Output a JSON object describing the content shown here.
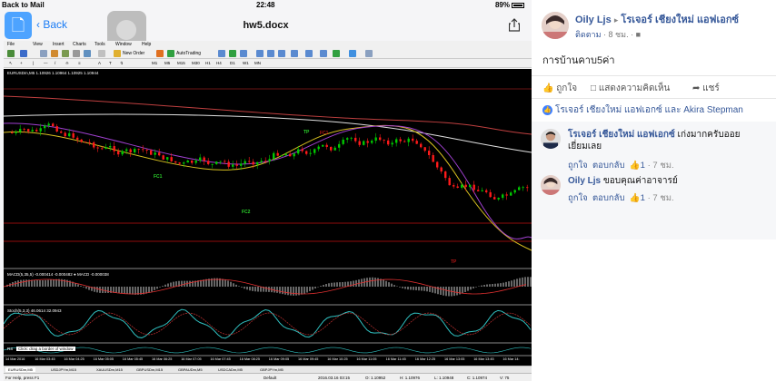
{
  "status_bar": {
    "back": "Back to Mail",
    "time": "22:48",
    "battery": "89%"
  },
  "nav": {
    "back_label": "Back",
    "doc_title": "hw5.docx"
  },
  "mt4": {
    "menu": [
      "File",
      "View",
      "Insert",
      "Charts",
      "Tools",
      "Window",
      "Help"
    ],
    "toolbar": {
      "new_order": "New Order",
      "autotrading": "AutoTrading"
    },
    "timeframes": [
      "M1",
      "M5",
      "M15",
      "M30",
      "H1",
      "H4",
      "D1",
      "W1",
      "MN"
    ],
    "chart": {
      "symbol_header": "EURUSDm,M5  1.10926 1.10964 1.10925 1.10944",
      "wave_labels": [
        "FC1",
        "FC2"
      ],
      "tp_labels": [
        "TP",
        "FC1",
        "TP"
      ],
      "macd_label": "MACD(5,35,5) -0.000414 -0.000482 ● MACD -0.000038",
      "stoch_label": "Stoch(5,3,3) 46.0614 32.0943",
      "rsi_label": "RS",
      "tooltip": "Click: drag a border of window",
      "time_labels": [
        "14 Mar 2016",
        "16 Mar 03:45",
        "16 Mar 04:25",
        "16 Mar 05:05",
        "16 Mar 05:45",
        "16 Mar 06:25",
        "16 Mar 07:05",
        "16 Mar 07:45",
        "16 Mar 08:25",
        "16 Mar 09:05",
        "16 Mar 09:45",
        "16 Mar 10:25",
        "16 Mar 11:05",
        "16 Mar 11:45",
        "16 Mar 12:25",
        "16 Mar 13:05",
        "16 Mar 13:45",
        "16 Mar 14:"
      ]
    },
    "symbol_tabs": [
      "EURUSDm,M5",
      "USDJPYm,M15",
      "XAUUSDm,M15",
      "GBPUSDm,M15",
      "GBPAUDm,M5",
      "USDCADm,M5",
      "GBPJPYm,M5"
    ],
    "status": {
      "help": "For Help, press F1",
      "profile": "Default",
      "datetime": "2016.03.16 03:15",
      "open": "O: 1.10952",
      "high": "H: 1.10976",
      "low": "L: 1.10948",
      "close": "C: 1.10974",
      "volume": "V: 75"
    }
  },
  "fb": {
    "post": {
      "author": "Oily Ljs",
      "arrow": "▸",
      "target": "โรเจอร์ เชียงใหม่ แอฟเอกซ์",
      "follow": "ติดตาม",
      "time": "8 ชม.",
      "text": "การบ้านคาบ5ค่า"
    },
    "actions": {
      "like": "ถูกใจ",
      "comment": "แสดงความคิดเห็น",
      "share": "แชร์"
    },
    "reactions": "โรเจอร์ เชียงใหม่ แอฟเอกซ์ และ Akira Stepman",
    "comments": [
      {
        "author": "โรเจอร์ เชียงใหม่ แอฟเอกซ์",
        "text_line1": "เก่งมากครับออย",
        "text_line2": "เยี่ยมเลย",
        "like": "ถูกใจ",
        "reply": "ตอบกลับ",
        "likes": "1",
        "time": "7 ชม."
      },
      {
        "author": "Oily Ljs",
        "text": "ขอบคุณค่าอาจารย์",
        "like": "ถูกใจ",
        "reply": "ตอบกลับ",
        "likes": "1",
        "time": "7 ชม."
      }
    ]
  },
  "colors": {
    "fb_blue": "#365899",
    "ios_blue": "#1a7cf5",
    "bull": "#00c800",
    "bear": "#ff1a1a",
    "chart_bg": "#000000"
  }
}
